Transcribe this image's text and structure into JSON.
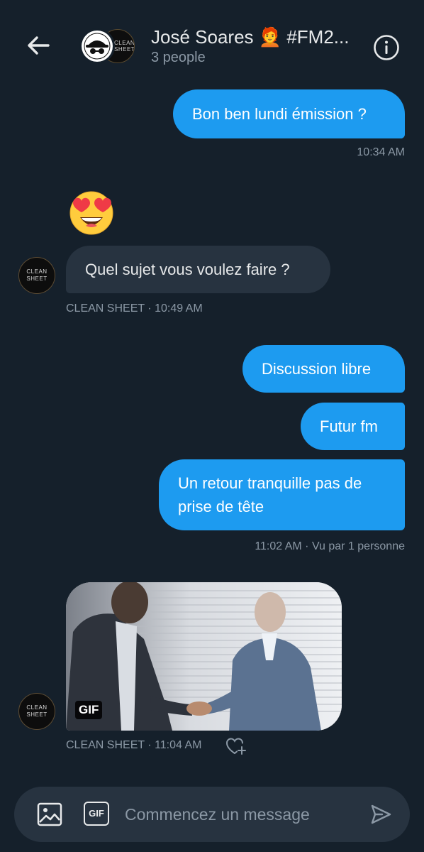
{
  "header": {
    "title": "José Soares 🧑‍🦰 #FM2...",
    "subtitle": "3 people",
    "avatar_text": "CLEAN SHEET",
    "icons": {
      "back": "arrow-left-icon",
      "info": "info-icon"
    }
  },
  "messages": [
    {
      "direction": "out",
      "text": "Bon ben lundi émission ?",
      "meta": "10:34 AM"
    },
    {
      "direction": "in",
      "type": "emoji",
      "emoji": "heart-eyes-emoji"
    },
    {
      "direction": "in",
      "text": "Quel sujet vous voulez faire ?",
      "meta": "CLEAN SHEET · 10:49 AM",
      "avatar_text": "CLEAN SHEET"
    },
    {
      "direction": "out",
      "text": "Discussion libre"
    },
    {
      "direction": "out",
      "text": "Futur fm"
    },
    {
      "direction": "out",
      "text_lines": [
        "Un retour tranquille pas de",
        "prise de tête"
      ],
      "meta": "11:02 AM · Vu par 1 personne"
    },
    {
      "direction": "in",
      "type": "gif",
      "badge": "GIF",
      "meta": "CLEAN SHEET · 11:04 AM",
      "avatar_text": "CLEAN SHEET"
    }
  ],
  "composer": {
    "placeholder": "Commencez un message",
    "gif_label": "GIF",
    "icons": {
      "media": "image-icon",
      "send": "send-icon"
    }
  },
  "colors": {
    "background": "#15202b",
    "outgoing_bubble": "#1d9bf0",
    "incoming_bubble": "#273340",
    "secondary_text": "#8b98a5"
  }
}
